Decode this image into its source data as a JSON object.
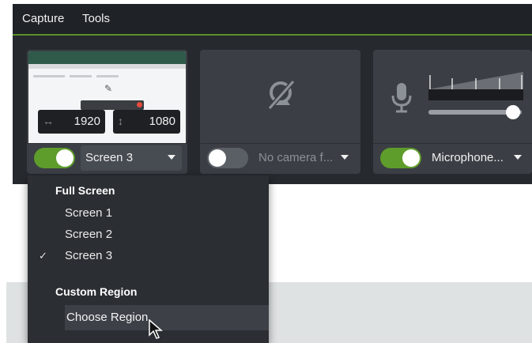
{
  "menubar": {
    "items": [
      "Capture",
      "Tools"
    ]
  },
  "screen_card": {
    "width_value": "1920",
    "height_value": "1080",
    "toggle_on": true,
    "selected": "Screen 3"
  },
  "camera_card": {
    "toggle_on": false,
    "selected": "No camera f..."
  },
  "audio_card": {
    "toggle_on": true,
    "selected": "Microphone...",
    "volume_level": 0.9
  },
  "dropdown": {
    "section_full": "Full Screen",
    "screens": [
      "Screen 1",
      "Screen 2",
      "Screen 3"
    ],
    "checked": "Screen 3",
    "check_glyph": "✓",
    "section_custom": "Custom Region",
    "custom_item": "Choose Region"
  },
  "colors": {
    "accent_green": "#5e9c2b",
    "panel": "#26292e",
    "card": "#3b3f45",
    "menu": "#2b2e33"
  }
}
